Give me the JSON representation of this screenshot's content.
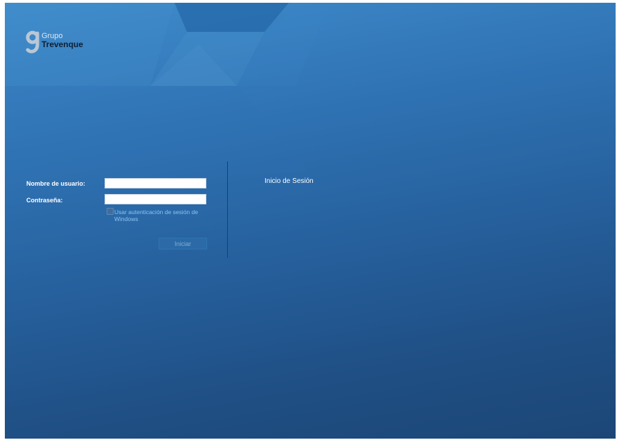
{
  "logo": {
    "line1": "Grupo",
    "line2": "Trevenque"
  },
  "form": {
    "username_label": "Nombre de usuario:",
    "username_value": "",
    "password_label": "Contraseña:",
    "password_value": "",
    "windows_auth_label": "Usar autenticación de sesión de Windows",
    "windows_auth_checked": false,
    "submit_label": "Iniciar"
  },
  "title": "Inicio de Sesión",
  "colors": {
    "background_top": "#3f8ccc",
    "background_bottom": "#1c4677",
    "link_text": "#8cc3f2"
  }
}
